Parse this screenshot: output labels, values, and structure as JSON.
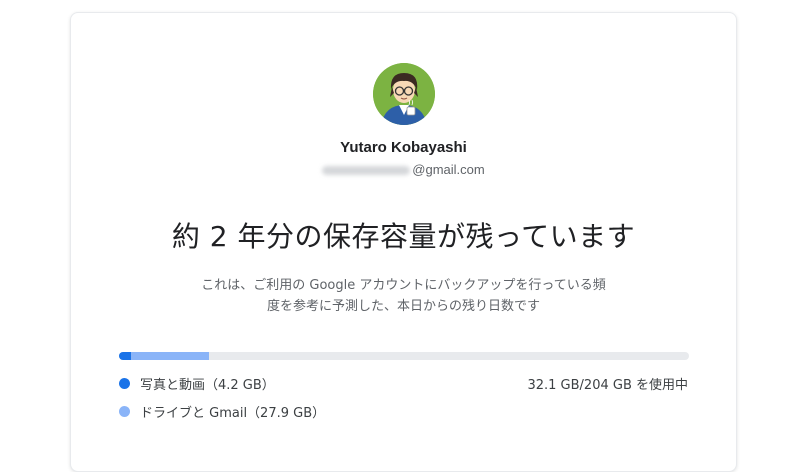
{
  "account": {
    "name": "Yutaro Kobayashi",
    "email_suffix": "@gmail.com"
  },
  "headline": "約 2 年分の保存容量が残っています",
  "description": {
    "line1": "これは、ご利用の Google アカウントにバックアップを行っている頻",
    "line2": "度を参考に予測した、本日からの残り日数です"
  },
  "storage": {
    "usage_label": "32.1 GB/204 GB を使用中",
    "total_gb": 204,
    "segments": [
      {
        "label": "写真と動画（4.2 GB）",
        "gb": 4.2,
        "color": "#1a73e8"
      },
      {
        "label": "ドライブと Gmail（27.9 GB）",
        "gb": 27.9,
        "color": "#8ab4f8"
      }
    ]
  },
  "colors": {
    "avatar_bg": "#7cb342",
    "track": "#e8eaed"
  }
}
